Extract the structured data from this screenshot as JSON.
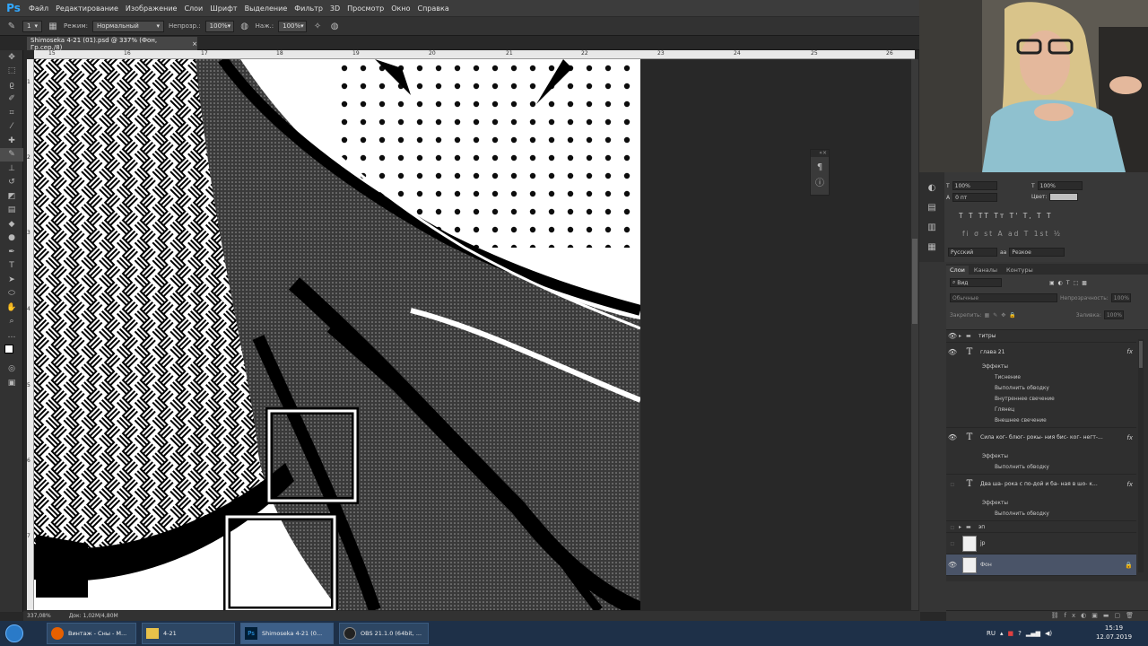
{
  "app": {
    "logo": "Ps"
  },
  "menu": [
    "Файл",
    "Редактирование",
    "Изображение",
    "Слои",
    "Шрифт",
    "Выделение",
    "Фильтр",
    "3D",
    "Просмотр",
    "Окно",
    "Справка"
  ],
  "options": {
    "mode_label": "Режим:",
    "mode_value": "Нормальный",
    "opacity_label": "Непрозр.:",
    "opacity_value": "100%",
    "pressure_label": "Наж.:",
    "pressure_value": "100%",
    "brush_size": "1"
  },
  "document": {
    "tab_title": "Shimoseka 4-21 (01).psd @ 337% (Фон, Гр.сер./8)",
    "close_glyph": "×",
    "ruler_top": [
      "15",
      "16",
      "17",
      "18",
      "19",
      "20",
      "21",
      "22",
      "23",
      "24",
      "25",
      "26"
    ],
    "ruler_left": [
      "1",
      "2",
      "3",
      "4",
      "5",
      "6",
      "7"
    ],
    "zoom": "337,08%",
    "doc_size": "Док: 1,02М/4,80М"
  },
  "character_panel": {
    "size_a": "100%",
    "size_b": "100%",
    "tracking": "0 пт",
    "color_label": "Цвет:",
    "style_buttons": "T T TT Tт T' T, T T",
    "features_row": "fi σ st A ad T 1st ½",
    "language": "Русский",
    "aa_label": "aa",
    "aa_value": "Резкое"
  },
  "layers_panel": {
    "tabs": [
      "Слои",
      "Каналы",
      "Контуры"
    ],
    "filter_label": "Вид",
    "blend_mode": "Обычные",
    "opacity_label": "Непрозрачность:",
    "opacity_value": "100%",
    "lock_label": "Закрепить:",
    "fill_label": "Заливка:",
    "fill_value": "100%",
    "layers": [
      {
        "name": "титры",
        "kind": "group"
      },
      {
        "name": "глава 21",
        "kind": "text",
        "fx": "fx",
        "effects_label": "Эффекты",
        "effects": [
          "Тиснение",
          "Выполнить обводку",
          "Внутреннее свечение",
          "Глянец",
          "Внешнее свечение"
        ]
      },
      {
        "name": "Сила ког- блюг- рокы- ния бис- ког- негт-...",
        "kind": "text",
        "fx": "fx",
        "effects_label": "Эффекты",
        "effects": [
          "Выполнить обводку"
        ]
      },
      {
        "name": "Два ша- рока с по-дой и ба- ная в шо- к...",
        "kind": "text",
        "fx": "fx",
        "effects_label": "Эффекты",
        "effects": [
          "Выполнить обводку"
        ]
      },
      {
        "name": "эп",
        "kind": "group"
      },
      {
        "name": "jp",
        "kind": "image"
      },
      {
        "name": "Фон",
        "kind": "image-selected"
      }
    ]
  },
  "taskbar": {
    "items": [
      {
        "label": "Винтаж - Сны - М..."
      },
      {
        "label": "4-21"
      },
      {
        "label": "Shimoseka 4-21 (0..."
      },
      {
        "label": "OBS 21.1.0 (64bit, ..."
      }
    ],
    "lang": "RU",
    "time": "15:19",
    "date": "12.07.2019"
  }
}
